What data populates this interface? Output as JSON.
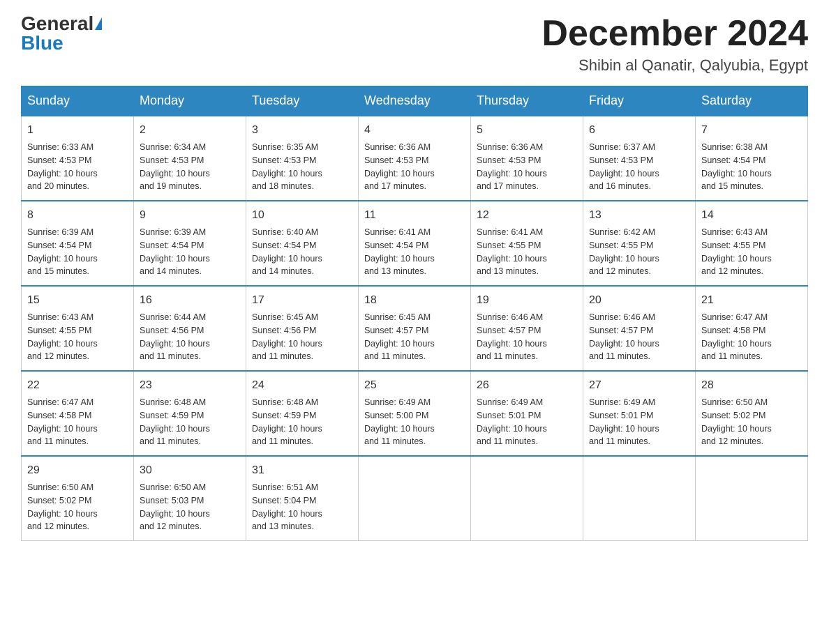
{
  "logo": {
    "general": "General",
    "blue": "Blue"
  },
  "title": "December 2024",
  "location": "Shibin al Qanatir, Qalyubia, Egypt",
  "weekdays": [
    "Sunday",
    "Monday",
    "Tuesday",
    "Wednesday",
    "Thursday",
    "Friday",
    "Saturday"
  ],
  "weeks": [
    [
      {
        "day": 1,
        "sunrise": "6:33 AM",
        "sunset": "4:53 PM",
        "daylight": "10 hours and 20 minutes."
      },
      {
        "day": 2,
        "sunrise": "6:34 AM",
        "sunset": "4:53 PM",
        "daylight": "10 hours and 19 minutes."
      },
      {
        "day": 3,
        "sunrise": "6:35 AM",
        "sunset": "4:53 PM",
        "daylight": "10 hours and 18 minutes."
      },
      {
        "day": 4,
        "sunrise": "6:36 AM",
        "sunset": "4:53 PM",
        "daylight": "10 hours and 17 minutes."
      },
      {
        "day": 5,
        "sunrise": "6:36 AM",
        "sunset": "4:53 PM",
        "daylight": "10 hours and 17 minutes."
      },
      {
        "day": 6,
        "sunrise": "6:37 AM",
        "sunset": "4:53 PM",
        "daylight": "10 hours and 16 minutes."
      },
      {
        "day": 7,
        "sunrise": "6:38 AM",
        "sunset": "4:54 PM",
        "daylight": "10 hours and 15 minutes."
      }
    ],
    [
      {
        "day": 8,
        "sunrise": "6:39 AM",
        "sunset": "4:54 PM",
        "daylight": "10 hours and 15 minutes."
      },
      {
        "day": 9,
        "sunrise": "6:39 AM",
        "sunset": "4:54 PM",
        "daylight": "10 hours and 14 minutes."
      },
      {
        "day": 10,
        "sunrise": "6:40 AM",
        "sunset": "4:54 PM",
        "daylight": "10 hours and 14 minutes."
      },
      {
        "day": 11,
        "sunrise": "6:41 AM",
        "sunset": "4:54 PM",
        "daylight": "10 hours and 13 minutes."
      },
      {
        "day": 12,
        "sunrise": "6:41 AM",
        "sunset": "4:55 PM",
        "daylight": "10 hours and 13 minutes."
      },
      {
        "day": 13,
        "sunrise": "6:42 AM",
        "sunset": "4:55 PM",
        "daylight": "10 hours and 12 minutes."
      },
      {
        "day": 14,
        "sunrise": "6:43 AM",
        "sunset": "4:55 PM",
        "daylight": "10 hours and 12 minutes."
      }
    ],
    [
      {
        "day": 15,
        "sunrise": "6:43 AM",
        "sunset": "4:55 PM",
        "daylight": "10 hours and 12 minutes."
      },
      {
        "day": 16,
        "sunrise": "6:44 AM",
        "sunset": "4:56 PM",
        "daylight": "10 hours and 11 minutes."
      },
      {
        "day": 17,
        "sunrise": "6:45 AM",
        "sunset": "4:56 PM",
        "daylight": "10 hours and 11 minutes."
      },
      {
        "day": 18,
        "sunrise": "6:45 AM",
        "sunset": "4:57 PM",
        "daylight": "10 hours and 11 minutes."
      },
      {
        "day": 19,
        "sunrise": "6:46 AM",
        "sunset": "4:57 PM",
        "daylight": "10 hours and 11 minutes."
      },
      {
        "day": 20,
        "sunrise": "6:46 AM",
        "sunset": "4:57 PM",
        "daylight": "10 hours and 11 minutes."
      },
      {
        "day": 21,
        "sunrise": "6:47 AM",
        "sunset": "4:58 PM",
        "daylight": "10 hours and 11 minutes."
      }
    ],
    [
      {
        "day": 22,
        "sunrise": "6:47 AM",
        "sunset": "4:58 PM",
        "daylight": "10 hours and 11 minutes."
      },
      {
        "day": 23,
        "sunrise": "6:48 AM",
        "sunset": "4:59 PM",
        "daylight": "10 hours and 11 minutes."
      },
      {
        "day": 24,
        "sunrise": "6:48 AM",
        "sunset": "4:59 PM",
        "daylight": "10 hours and 11 minutes."
      },
      {
        "day": 25,
        "sunrise": "6:49 AM",
        "sunset": "5:00 PM",
        "daylight": "10 hours and 11 minutes."
      },
      {
        "day": 26,
        "sunrise": "6:49 AM",
        "sunset": "5:01 PM",
        "daylight": "10 hours and 11 minutes."
      },
      {
        "day": 27,
        "sunrise": "6:49 AM",
        "sunset": "5:01 PM",
        "daylight": "10 hours and 11 minutes."
      },
      {
        "day": 28,
        "sunrise": "6:50 AM",
        "sunset": "5:02 PM",
        "daylight": "10 hours and 12 minutes."
      }
    ],
    [
      {
        "day": 29,
        "sunrise": "6:50 AM",
        "sunset": "5:02 PM",
        "daylight": "10 hours and 12 minutes."
      },
      {
        "day": 30,
        "sunrise": "6:50 AM",
        "sunset": "5:03 PM",
        "daylight": "10 hours and 12 minutes."
      },
      {
        "day": 31,
        "sunrise": "6:51 AM",
        "sunset": "5:04 PM",
        "daylight": "10 hours and 13 minutes."
      },
      null,
      null,
      null,
      null
    ]
  ],
  "labels": {
    "sunrise": "Sunrise:",
    "sunset": "Sunset:",
    "daylight": "Daylight:"
  }
}
